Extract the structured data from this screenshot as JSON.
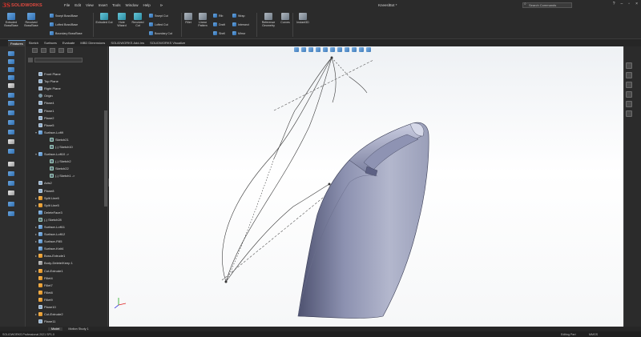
{
  "app": {
    "brand": "SOLIDWORKS",
    "menus": [
      "File",
      "Edit",
      "View",
      "Insert",
      "Tools",
      "Window",
      "Help"
    ],
    "document_title": "KneeslBot *",
    "search_placeholder": "Search Commands"
  },
  "ribbon": {
    "extruded_boss": "Extruded Boss/Base",
    "revolved_boss": "Revolved Boss/Base",
    "swept_boss": "Swept Boss/Base",
    "lofted_boss": "Lofted Boss/Base",
    "boundary_boss": "Boundary Boss/Base",
    "extruded_cut": "Extruded Cut",
    "hole_wizard": "Hole Wizard",
    "revolved_cut": "Revolved Cut",
    "swept_cut": "Swept Cut",
    "lofted_cut": "Lofted Cut",
    "boundary_cut": "Boundary Cut",
    "fillet": "Fillet",
    "linear_pattern": "Linear Pattern",
    "rib": "Rib",
    "draft": "Draft",
    "shell": "Shell",
    "wrap": "Wrap",
    "intersect": "Intersect",
    "mirror": "Mirror",
    "reference_geometry": "Reference Geometry",
    "curves": "Curves",
    "instant3d": "Instant3D"
  },
  "tabs": [
    "Features",
    "Sketch",
    "Surfaces",
    "Evaluate",
    "MBD Dimensions",
    "SOLIDWORKS Add-Ins",
    "SOLIDWORKS Visualize"
  ],
  "tree": [
    {
      "label": "Front Plane",
      "icon": "plane-icon",
      "level": 0,
      "exp": ""
    },
    {
      "label": "Top Plane",
      "icon": "plane-icon",
      "level": 0,
      "exp": ""
    },
    {
      "label": "Right Plane",
      "icon": "plane-icon",
      "level": 0,
      "exp": ""
    },
    {
      "label": "Origin",
      "icon": "origin-icon",
      "level": 0,
      "exp": ""
    },
    {
      "label": "Plane4",
      "icon": "plane-icon",
      "level": 0,
      "exp": ""
    },
    {
      "label": "Plane1",
      "icon": "plane-icon",
      "level": 0,
      "exp": ""
    },
    {
      "label": "Plane2",
      "icon": "plane-icon",
      "level": 0,
      "exp": ""
    },
    {
      "label": "Plane5",
      "icon": "plane-icon",
      "level": 0,
      "exp": ""
    },
    {
      "label": "Surface-Loft9",
      "icon": "surface-icon",
      "level": 0,
      "exp": "▾"
    },
    {
      "label": "Sketch21",
      "icon": "sketch-icon",
      "level": 1,
      "exp": ""
    },
    {
      "label": "(-) Sketch10",
      "icon": "sketch-icon",
      "level": 1,
      "exp": ""
    },
    {
      "label": "Surface-Loft10 -> ",
      "icon": "surface-icon",
      "level": 0,
      "exp": "▾"
    },
    {
      "label": "(-) Sketch2",
      "icon": "sketch-icon",
      "level": 1,
      "exp": ""
    },
    {
      "label": "Sketch22",
      "icon": "sketch-icon",
      "level": 1,
      "exp": ""
    },
    {
      "label": "(-) Sketch1 ->",
      "icon": "sketch-icon",
      "level": 1,
      "exp": ""
    },
    {
      "label": "Axis2",
      "icon": "plane-icon",
      "level": 0,
      "exp": ""
    },
    {
      "label": "Plane8",
      "icon": "plane-icon",
      "level": 0,
      "exp": ""
    },
    {
      "label": "Split Line6",
      "icon": "feature-icon",
      "level": 0,
      "exp": "▸"
    },
    {
      "label": "Split Line5",
      "icon": "feature-icon",
      "level": 0,
      "exp": "▸"
    },
    {
      "label": "DeleteFace3",
      "icon": "surface-icon",
      "level": 0,
      "exp": ""
    },
    {
      "label": "(-) Sketch28",
      "icon": "sketch-icon",
      "level": 0,
      "exp": ""
    },
    {
      "label": "Surface-Loft11",
      "icon": "surface-icon",
      "level": 0,
      "exp": "▸"
    },
    {
      "label": "Surface-Loft12",
      "icon": "surface-icon",
      "level": 0,
      "exp": "▸"
    },
    {
      "label": "Surface-Fill5",
      "icon": "surface-icon",
      "level": 0,
      "exp": "▸"
    },
    {
      "label": "Surface-Knit4",
      "icon": "surface-icon",
      "level": 0,
      "exp": ""
    },
    {
      "label": "Boss-Extrude1",
      "icon": "feature-icon",
      "level": 0,
      "exp": "▸"
    },
    {
      "label": "Body-Delete/Keep 1",
      "icon": "body-icon",
      "level": 0,
      "exp": ""
    },
    {
      "label": "Cut-Extrude1",
      "icon": "feature-icon",
      "level": 0,
      "exp": "▸"
    },
    {
      "label": "Fillet4",
      "icon": "feature-icon",
      "level": 0,
      "exp": ""
    },
    {
      "label": "Fillet7",
      "icon": "feature-icon",
      "level": 0,
      "exp": ""
    },
    {
      "label": "Fillet8",
      "icon": "feature-icon",
      "level": 0,
      "exp": ""
    },
    {
      "label": "Fillet9",
      "icon": "feature-icon",
      "level": 0,
      "exp": ""
    },
    {
      "label": "Plane10",
      "icon": "plane-icon",
      "level": 0,
      "exp": ""
    },
    {
      "label": "Cut-Extrude2",
      "icon": "feature-icon",
      "level": 0,
      "exp": "▸"
    },
    {
      "label": "Plane11",
      "icon": "plane-icon",
      "level": 0,
      "exp": ""
    }
  ],
  "bottom_tabs": [
    "Model",
    "Motion Study 1"
  ],
  "status": {
    "left": "SOLIDWORKS Professional 2021 SP1.0",
    "editing": "Editing Part",
    "units": "MMGS"
  }
}
